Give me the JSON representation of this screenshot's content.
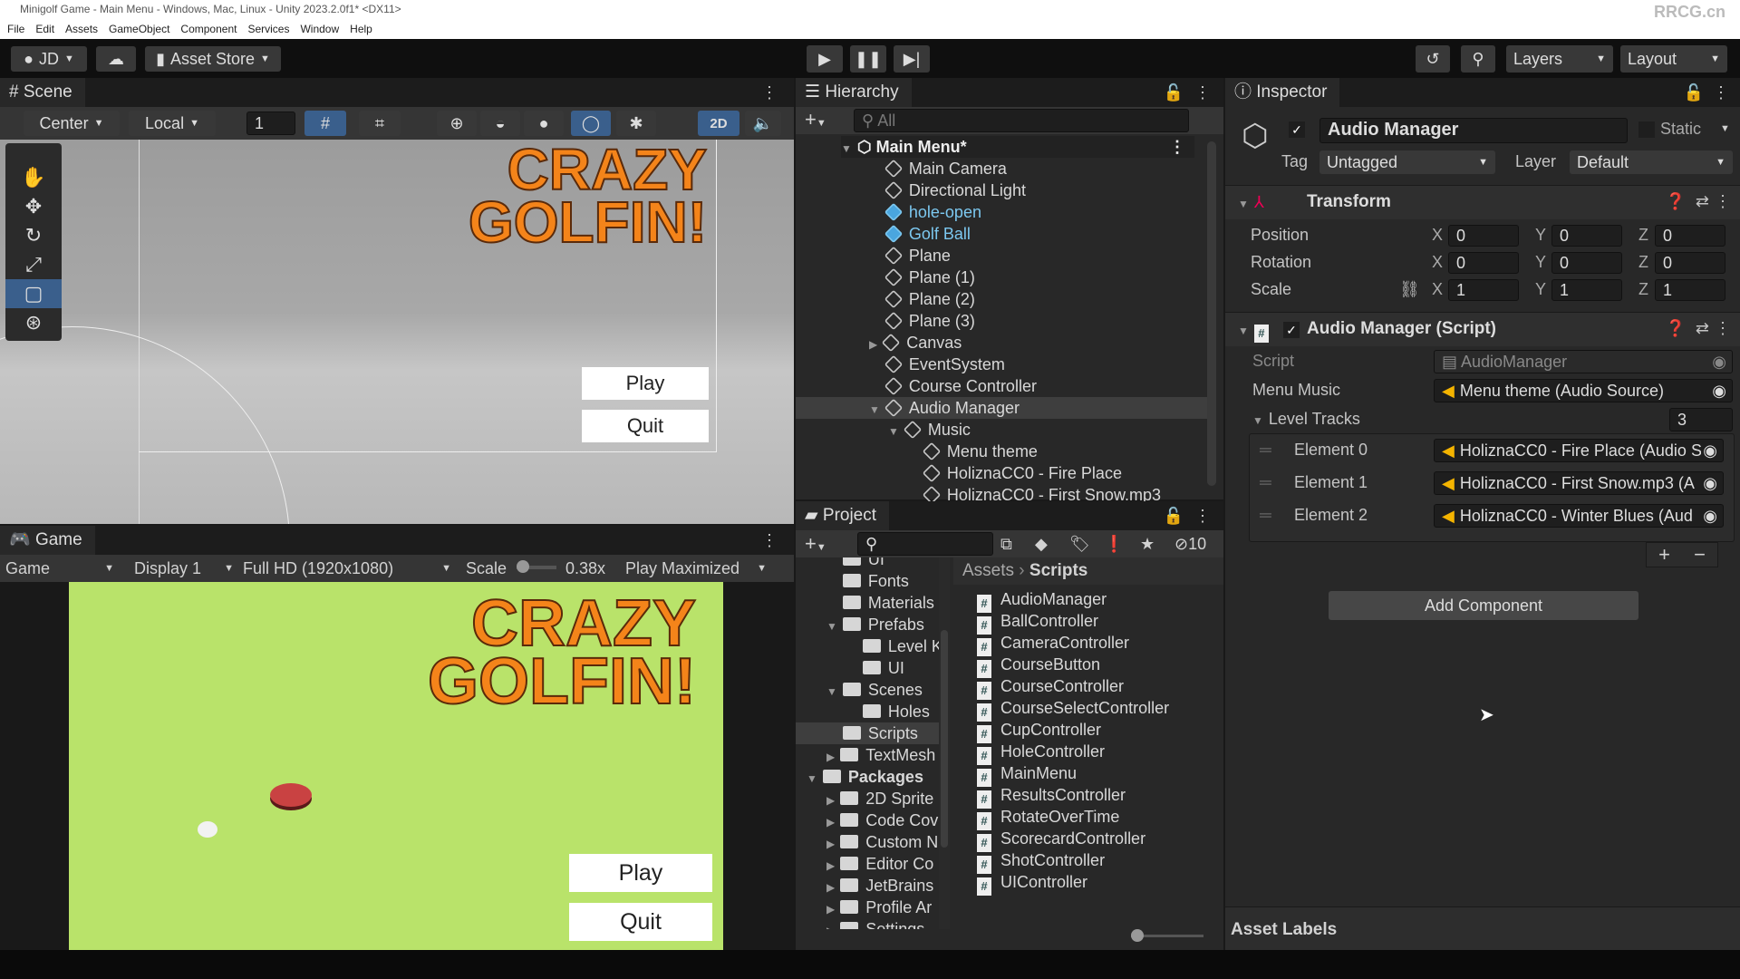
{
  "window": {
    "title": "Minigolf Game - Main Menu - Windows, Mac, Linux - Unity 2023.2.0f1* <DX11>",
    "watermark": "RRCG.cn"
  },
  "menu": [
    "File",
    "Edit",
    "Assets",
    "GameObject",
    "Component",
    "Services",
    "Window",
    "Help"
  ],
  "toolbar": {
    "account": "JD",
    "asset_store": "Asset Store",
    "layers": "Layers",
    "layout": "Layout"
  },
  "scene": {
    "tab": "Scene",
    "pivot": "Center",
    "space": "Local",
    "grid_value": "1",
    "mode_2d": "2D",
    "logo_line1": "CRAZY",
    "logo_line2": "GOLFIN!",
    "play": "Play",
    "quit": "Quit"
  },
  "game": {
    "tab": "Game",
    "view": "Game",
    "display": "Display 1",
    "resolution": "Full HD (1920x1080)",
    "scale_label": "Scale",
    "scale_value": "0.38x",
    "play_mode": "Play Maximized",
    "logo_line1": "CRAZY",
    "logo_line2": "GOLFIN!",
    "play": "Play",
    "quit": "Quit"
  },
  "hierarchy": {
    "tab": "Hierarchy",
    "search_placeholder": "All",
    "scene": "Main Menu*",
    "items": [
      {
        "label": "Main Camera",
        "depth": 1
      },
      {
        "label": "Directional Light",
        "depth": 1
      },
      {
        "label": "hole-open",
        "depth": 1,
        "prefab": true
      },
      {
        "label": "Golf Ball",
        "depth": 1,
        "prefab": true
      },
      {
        "label": "Plane",
        "depth": 1
      },
      {
        "label": "Plane (1)",
        "depth": 1
      },
      {
        "label": "Plane (2)",
        "depth": 1
      },
      {
        "label": "Plane (3)",
        "depth": 1
      },
      {
        "label": "Canvas",
        "depth": 1,
        "arrow": "collapsed"
      },
      {
        "label": "EventSystem",
        "depth": 1
      },
      {
        "label": "Course Controller",
        "depth": 1
      },
      {
        "label": "Audio Manager",
        "depth": 1,
        "arrow": "expanded",
        "selected": true
      },
      {
        "label": "Music",
        "depth": 2,
        "arrow": "expanded"
      },
      {
        "label": "Menu theme",
        "depth": 3
      },
      {
        "label": "HoliznaCC0 - Fire Place",
        "depth": 3
      },
      {
        "label": "HoliznaCC0 - First Snow.mp3",
        "depth": 3
      }
    ]
  },
  "project": {
    "tab": "Project",
    "hidden_count": "10",
    "breadcrumb_root": "Assets",
    "breadcrumb_current": "Scripts",
    "tree": [
      {
        "label": "UI",
        "depth": 1
      },
      {
        "label": "Fonts",
        "depth": 1
      },
      {
        "label": "Materials",
        "depth": 1
      },
      {
        "label": "Prefabs",
        "depth": 1,
        "arrow": "expanded"
      },
      {
        "label": "Level K",
        "depth": 2
      },
      {
        "label": "UI",
        "depth": 2
      },
      {
        "label": "Scenes",
        "depth": 1,
        "arrow": "expanded"
      },
      {
        "label": "Holes",
        "depth": 2
      },
      {
        "label": "Scripts",
        "depth": 1,
        "selected": true
      },
      {
        "label": "TextMesh",
        "depth": 1,
        "arrow": "collapsed"
      },
      {
        "label": "Packages",
        "depth": 0,
        "arrow": "expanded",
        "bold": true
      },
      {
        "label": "2D Sprite",
        "depth": 1,
        "arrow": "collapsed"
      },
      {
        "label": "Code Cov",
        "depth": 1,
        "arrow": "collapsed"
      },
      {
        "label": "Custom N",
        "depth": 1,
        "arrow": "collapsed"
      },
      {
        "label": "Editor Co",
        "depth": 1,
        "arrow": "collapsed"
      },
      {
        "label": "JetBrains",
        "depth": 1,
        "arrow": "collapsed"
      },
      {
        "label": "Profile Ar",
        "depth": 1,
        "arrow": "collapsed"
      },
      {
        "label": "Settings",
        "depth": 1,
        "arrow": "collapsed"
      }
    ],
    "files": [
      "AudioManager",
      "BallController",
      "CameraController",
      "CourseButton",
      "CourseController",
      "CourseSelectController",
      "CupController",
      "HoleController",
      "MainMenu",
      "ResultsController",
      "RotateOverTime",
      "ScorecardController",
      "ShotController",
      "UIController"
    ]
  },
  "inspector": {
    "tab": "Inspector",
    "object_name": "Audio Manager",
    "active": true,
    "static_label": "Static",
    "tag_label": "Tag",
    "tag": "Untagged",
    "layer_label": "Layer",
    "layer": "Default",
    "transform": {
      "title": "Transform",
      "rows": [
        {
          "label": "Position",
          "x": "0",
          "y": "0",
          "z": "0"
        },
        {
          "label": "Rotation",
          "x": "0",
          "y": "0",
          "z": "0"
        },
        {
          "label": "Scale",
          "x": "1",
          "y": "1",
          "z": "1"
        }
      ]
    },
    "script": {
      "title": "Audio Manager (Script)",
      "script_label": "Script",
      "script_value": "AudioManager",
      "menu_music_label": "Menu Music",
      "menu_music_value": "Menu theme (Audio Source)",
      "level_tracks_label": "Level Tracks",
      "level_tracks_count": "3",
      "elements": [
        {
          "label": "Element 0",
          "value": "HoliznaCC0 - Fire Place (Audio S"
        },
        {
          "label": "Element 1",
          "value": "HoliznaCC0 - First Snow.mp3 (A"
        },
        {
          "label": "Element 2",
          "value": "HoliznaCC0 - Winter Blues (Aud"
        }
      ]
    },
    "add_component": "Add Component",
    "asset_labels": "Asset Labels"
  },
  "colors": {
    "accent": "#3a5f8c",
    "prefab": "#7cc8f0",
    "game_bg": "#b9e36a",
    "logo": "#f07a1a"
  }
}
